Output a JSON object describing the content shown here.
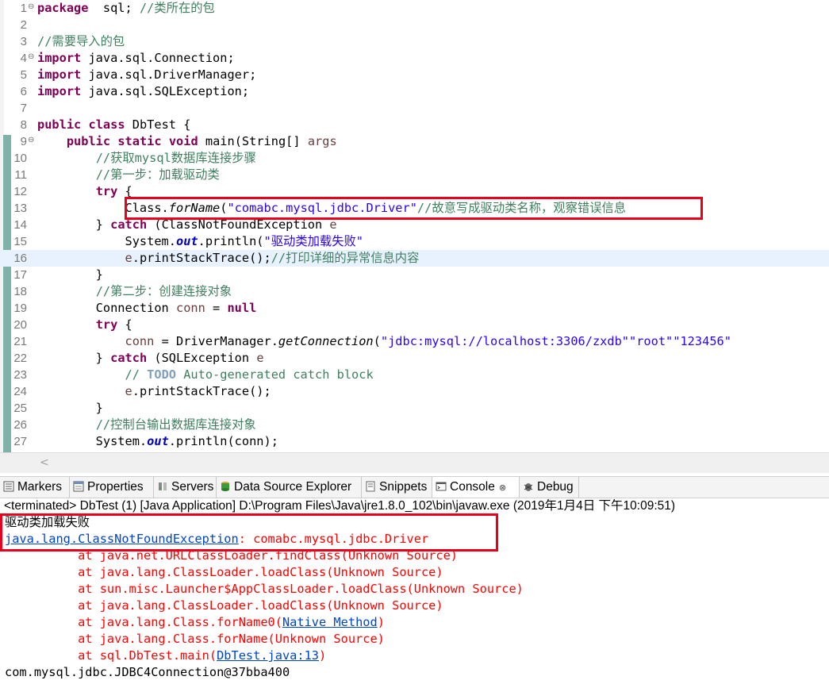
{
  "editor": {
    "lines": [
      {
        "n": "1",
        "fold": "⊖",
        "segs": [
          [
            "kw",
            "package"
          ],
          [
            "",
            "  sql; "
          ],
          [
            "cm",
            "//类所在的包"
          ]
        ]
      },
      {
        "n": "2",
        "segs": []
      },
      {
        "n": "3",
        "segs": [
          [
            "cm",
            "//需要导入的包"
          ]
        ]
      },
      {
        "n": "4",
        "fold": "⊖",
        "segs": [
          [
            "kw",
            "import"
          ],
          [
            "",
            " java.sql.Connection;"
          ]
        ]
      },
      {
        "n": "5",
        "segs": [
          [
            "kw",
            "import"
          ],
          [
            "",
            " java.sql.DriverManager;"
          ]
        ]
      },
      {
        "n": "6",
        "segs": [
          [
            "kw",
            "import"
          ],
          [
            "",
            " java.sql.SQLException;"
          ]
        ]
      },
      {
        "n": "7",
        "segs": []
      },
      {
        "n": "8",
        "segs": [
          [
            "kw",
            "public"
          ],
          [
            "",
            " "
          ],
          [
            "kw",
            "class"
          ],
          [
            "",
            " DbTest {"
          ]
        ]
      },
      {
        "n": "9",
        "fold": "⊖",
        "segs": [
          [
            "",
            "    "
          ],
          [
            "kw",
            "public"
          ],
          [
            "",
            " "
          ],
          [
            "kw",
            "static"
          ],
          [
            "",
            " "
          ],
          [
            "kw",
            "void"
          ],
          [
            "",
            " main(String[] "
          ],
          [
            "var",
            "args"
          ],
          [
            ") {"
          ]
        ]
      },
      {
        "n": "10",
        "segs": [
          [
            "",
            "        "
          ],
          [
            "cm",
            "//获取mysql数据库连接步骤"
          ]
        ]
      },
      {
        "n": "11",
        "segs": [
          [
            "",
            "        "
          ],
          [
            "cm",
            "//第一步：加载驱动类"
          ]
        ]
      },
      {
        "n": "12",
        "segs": [
          [
            "",
            "        "
          ],
          [
            "kw",
            "try"
          ],
          [
            "",
            " {"
          ]
        ]
      },
      {
        "n": "13",
        "segs": [
          [
            "",
            "            Class."
          ],
          [
            "st",
            "forName"
          ],
          [
            "",
            "("
          ],
          [
            "str",
            "\"comabc.mysql.jdbc.Driver\""
          ],
          [
            ");"
          ],
          [
            "cm",
            "//故意写成驱动类名称，观察错误信息"
          ]
        ]
      },
      {
        "n": "14",
        "segs": [
          [
            "",
            "        } "
          ],
          [
            "kw",
            "catch"
          ],
          [
            "",
            " (ClassNotFoundException "
          ],
          [
            "var",
            "e"
          ],
          [
            ") {"
          ]
        ]
      },
      {
        "n": "15",
        "segs": [
          [
            "",
            "            System."
          ],
          [
            "fld",
            "out"
          ],
          [
            "",
            ".println("
          ],
          [
            "str",
            "\"驱动类加载失败\""
          ],
          [
            ");"
          ]
        ]
      },
      {
        "n": "16",
        "segs": [
          [
            "",
            "            "
          ],
          [
            "var",
            "e"
          ],
          [
            "",
            ".printStackTrace();"
          ],
          [
            "cm",
            "//打印详细的异常信息内容"
          ]
        ]
      },
      {
        "n": "17",
        "segs": [
          [
            "",
            "        }"
          ]
        ]
      },
      {
        "n": "18",
        "segs": [
          [
            "",
            "        "
          ],
          [
            "cm",
            "//第二步：创建连接对象"
          ]
        ]
      },
      {
        "n": "19",
        "segs": [
          [
            "",
            "        Connection "
          ],
          [
            "var",
            "conn"
          ],
          [
            "",
            " = "
          ],
          [
            "kw",
            "null"
          ],
          [
            ";"
          ]
        ]
      },
      {
        "n": "20",
        "segs": [
          [
            "",
            "        "
          ],
          [
            "kw",
            "try"
          ],
          [
            "",
            " {"
          ]
        ]
      },
      {
        "n": "21",
        "segs": [
          [
            "",
            "            "
          ],
          [
            "var",
            "conn"
          ],
          [
            "",
            " = DriverManager."
          ],
          [
            "st",
            "getConnection"
          ],
          [
            "",
            "("
          ],
          [
            "str",
            "\"jdbc:mysql://localhost:3306/zxdb\""
          ],
          [
            ","
          ],
          [
            "str",
            "\"root\""
          ],
          [
            ","
          ],
          [
            "str",
            "\"123456\""
          ],
          [
            ");"
          ]
        ]
      },
      {
        "n": "22",
        "segs": [
          [
            "",
            "        } "
          ],
          [
            "kw",
            "catch"
          ],
          [
            "",
            " (SQLException "
          ],
          [
            "var",
            "e"
          ],
          [
            ") {"
          ]
        ]
      },
      {
        "n": "23",
        "segs": [
          [
            "",
            "            "
          ],
          [
            "cm",
            "// "
          ],
          [
            "todo",
            "TODO"
          ],
          [
            "cm",
            " Auto-generated catch block"
          ]
        ]
      },
      {
        "n": "24",
        "segs": [
          [
            "",
            "            "
          ],
          [
            "var",
            "e"
          ],
          [
            "",
            ".printStackTrace();"
          ]
        ]
      },
      {
        "n": "25",
        "segs": [
          [
            "",
            "        }"
          ]
        ]
      },
      {
        "n": "26",
        "segs": [
          [
            "",
            "        "
          ],
          [
            "cm",
            "//控制台输出数据库连接对象"
          ]
        ]
      },
      {
        "n": "27",
        "segs": [
          [
            "",
            "        System."
          ],
          [
            "fld",
            "out"
          ],
          [
            "",
            ".println(conn);"
          ]
        ]
      }
    ],
    "current_line": "16",
    "scroll_left_glyph": "<"
  },
  "views": {
    "tabs": [
      {
        "label": "Markers",
        "icon": "markers-icon",
        "active": false
      },
      {
        "label": "Properties",
        "icon": "properties-icon",
        "active": false
      },
      {
        "label": "Servers",
        "icon": "servers-icon",
        "active": false
      },
      {
        "label": "Data Source Explorer",
        "icon": "data-source-explorer-icon",
        "active": false
      },
      {
        "label": "Snippets",
        "icon": "snippets-icon",
        "active": false
      },
      {
        "label": "Console",
        "icon": "console-icon",
        "active": true,
        "close": "⊗"
      },
      {
        "label": "Debug",
        "icon": "debug-icon",
        "active": false
      }
    ]
  },
  "console": {
    "status": "<terminated> DbTest (1) [Java Application] D:\\Program Files\\Java\\jre1.8.0_102\\bin\\javaw.exe (2019年1月4日 下午10:09:51)",
    "lines": [
      {
        "segs": [
          [
            "out",
            "驱动类加载失败"
          ]
        ]
      },
      {
        "segs": [
          [
            "lnk",
            "java.lang.ClassNotFoundException"
          ],
          [
            "err",
            ": comabc.mysql.jdbc.Driver"
          ]
        ]
      },
      {
        "segs": [
          [
            "err",
            "\tat java.net.URLClassLoader.findClass(Unknown Source)"
          ]
        ]
      },
      {
        "segs": [
          [
            "err",
            "\tat java.lang.ClassLoader.loadClass(Unknown Source)"
          ]
        ]
      },
      {
        "segs": [
          [
            "err",
            "\tat sun.misc.Launcher$AppClassLoader.loadClass(Unknown Source)"
          ]
        ]
      },
      {
        "segs": [
          [
            "err",
            "\tat java.lang.ClassLoader.loadClass(Unknown Source)"
          ]
        ]
      },
      {
        "segs": [
          [
            "err",
            "\tat java.lang.Class.forName0("
          ],
          [
            "lnk",
            "Native Method"
          ],
          [
            "err",
            ")"
          ]
        ]
      },
      {
        "segs": [
          [
            "err",
            "\tat java.lang.Class.forName(Unknown Source)"
          ]
        ]
      },
      {
        "segs": [
          [
            "err",
            "\tat sql.DbTest.main("
          ],
          [
            "lnk",
            "DbTest.java:13"
          ],
          [
            "err",
            ")"
          ]
        ]
      },
      {
        "segs": [
          [
            "out",
            "com.mysql.jdbc.JDBC4Connection@37bba400"
          ]
        ]
      }
    ]
  },
  "colors": {
    "keyword": "#7f0055",
    "comment": "#3f7f5f",
    "string": "#2a00ff",
    "local_var": "#6a3e3e",
    "static_field": "#0000c0",
    "error_text": "#ff0000",
    "hyperlink": "#0044cc",
    "annotation_box": "#e8001c",
    "current_line": "#e8f2fe"
  }
}
